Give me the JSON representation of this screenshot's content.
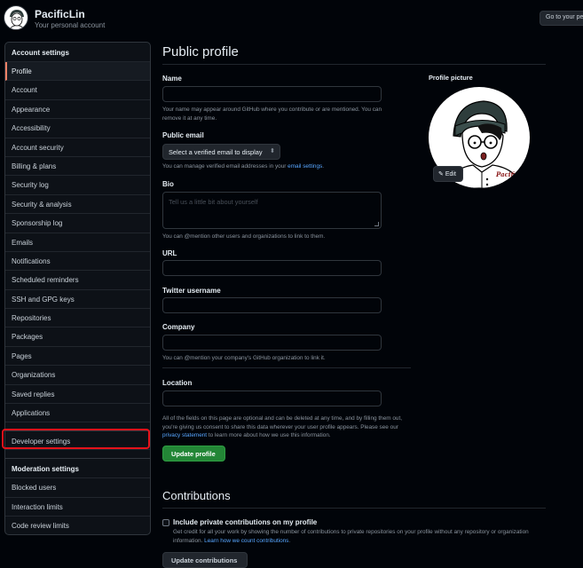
{
  "header": {
    "username": "PacificLin",
    "subtitle": "Your personal account",
    "goto_button": "Go to your personal profile"
  },
  "sidebar": {
    "account_settings_label": "Account settings",
    "items": [
      {
        "label": "Profile",
        "active": true
      },
      {
        "label": "Account"
      },
      {
        "label": "Appearance"
      },
      {
        "label": "Accessibility"
      },
      {
        "label": "Account security"
      },
      {
        "label": "Billing & plans"
      },
      {
        "label": "Security log"
      },
      {
        "label": "Security & analysis"
      },
      {
        "label": "Sponsorship log"
      },
      {
        "label": "Emails"
      },
      {
        "label": "Notifications"
      },
      {
        "label": "Scheduled reminders"
      },
      {
        "label": "SSH and GPG keys"
      },
      {
        "label": "Repositories"
      },
      {
        "label": "Packages"
      },
      {
        "label": "Pages"
      },
      {
        "label": "Organizations"
      },
      {
        "label": "Saved replies"
      },
      {
        "label": "Applications"
      }
    ],
    "developer_settings": "Developer settings",
    "moderation_label": "Moderation settings",
    "moderation_items": [
      {
        "label": "Blocked users"
      },
      {
        "label": "Interaction limits"
      },
      {
        "label": "Code review limits"
      }
    ]
  },
  "main": {
    "title": "Public profile",
    "name_label": "Name",
    "name_value": "",
    "name_note": "Your name may appear around GitHub where you contribute or are mentioned. You can remove it at any time.",
    "email_label": "Public email",
    "email_select": "Select a verified email to display",
    "email_note_prefix": "You can manage verified email addresses in your ",
    "email_note_link": "email settings",
    "email_note_suffix": ".",
    "bio_label": "Bio",
    "bio_placeholder": "Tell us a little bit about yourself",
    "bio_note": "You can @mention other users and organizations to link to them.",
    "url_label": "URL",
    "twitter_label": "Twitter username",
    "company_label": "Company",
    "company_note": "You can @mention your company's GitHub organization to link it.",
    "location_label": "Location",
    "privacy_note_prefix": "All of the fields on this page are optional and can be deleted at any time, and by filling them out, you're giving us consent to share this data wherever your user profile appears. Please see our ",
    "privacy_link": "privacy statement",
    "privacy_note_suffix": " to learn more about how we use this information.",
    "update_button": "Update profile",
    "contributions_title": "Contributions",
    "private_checkbox_label": "Include private contributions on my profile",
    "private_note_prefix": "Get credit for all your work by showing the number of contributions to private repositories on your profile without any repository or organization information. ",
    "private_note_link": "Learn how we count contributions",
    "private_note_suffix": ".",
    "update_contributions_button": "Update contributions"
  },
  "profile_picture": {
    "label": "Profile picture",
    "edit_button": "Edit",
    "signature_text": "Pacific"
  },
  "colors": {
    "background": "#010409",
    "accent_green": "#238636",
    "link_blue": "#58a6ff",
    "highlight_red": "#e5121a"
  }
}
